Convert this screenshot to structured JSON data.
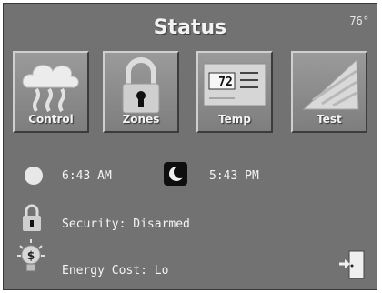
{
  "header": {
    "title": "Status",
    "temperature": "76°"
  },
  "buttons": [
    {
      "label": "Control",
      "icon": "control-icon"
    },
    {
      "label": "Zones",
      "icon": "lock-icon"
    },
    {
      "label": "Temp",
      "icon": "thermostat-icon",
      "display": "72"
    },
    {
      "label": "Test",
      "icon": "test-icon"
    }
  ],
  "sun": {
    "sunrise": "6:43 AM",
    "sunset": "5:43 PM"
  },
  "security": {
    "text": "Security: Disarmed"
  },
  "energy": {
    "text": "Energy Cost: Lo"
  },
  "colors": {
    "background": "#727272",
    "text": "#f4f4f4"
  }
}
